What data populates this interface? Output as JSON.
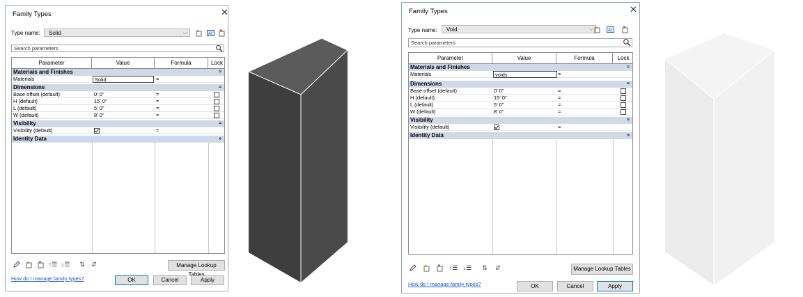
{
  "dialogs": [
    {
      "title": "Family Types",
      "type_name_label": "Type name:",
      "type_name": "Solid",
      "search_placeholder": "Search parameters",
      "columns": [
        "Parameter",
        "Value",
        "Formula",
        "Lock"
      ],
      "groups": [
        {
          "label": "Materials and Finishes",
          "chevron": "≈",
          "rows": [
            {
              "param": "Materials",
              "value": "Solid",
              "formula": "=",
              "lock": "",
              "value_box": true
            }
          ]
        },
        {
          "label": "Dimensions",
          "chevron": "≈",
          "rows": [
            {
              "param": "Base offset (default)",
              "value": "0'  0\"",
              "formula": "=",
              "lock": "checkbox"
            },
            {
              "param": "H (default)",
              "value": "15'  0\"",
              "formula": "=",
              "lock": "checkbox"
            },
            {
              "param": "L (default)",
              "value": "5'  0\"",
              "formula": "=",
              "lock": "checkbox"
            },
            {
              "param": "W (default)",
              "value": "8'  0\"",
              "formula": "=",
              "lock": "checkbox"
            }
          ]
        },
        {
          "label": "Visibility",
          "chevron": "≈",
          "rows": [
            {
              "param": "Visibility (default)",
              "value": "checked",
              "formula": "=",
              "lock": ""
            }
          ]
        },
        {
          "label": "Identity Data",
          "chevron": "»",
          "rows": []
        }
      ],
      "manage_lookup_label": "Manage Lookup Tables",
      "help_link": "How do I manage family types?",
      "ok_label": "OK",
      "cancel_label": "Cancel",
      "apply_label": "Apply"
    },
    {
      "title": "Family Types",
      "type_name_label": "Type name:",
      "type_name": "Void",
      "search_placeholder": "Search parameters",
      "columns": [
        "Parameter",
        "Value",
        "Formula",
        "Lock"
      ],
      "groups": [
        {
          "label": "Materials and Finishes",
          "chevron": "≈",
          "rows": [
            {
              "param": "Materials",
              "value": "voids",
              "formula": "=",
              "lock": "",
              "value_box": true
            }
          ]
        },
        {
          "label": "Dimensions",
          "chevron": "≈",
          "rows": [
            {
              "param": "Base offset (default)",
              "value": "0'  0\"",
              "formula": "=",
              "lock": "checkbox"
            },
            {
              "param": "H (default)",
              "value": "15'  0\"",
              "formula": "=",
              "lock": "checkbox"
            },
            {
              "param": "L (default)",
              "value": "5'  0\"",
              "formula": "=",
              "lock": "checkbox"
            },
            {
              "param": "W (default)",
              "value": "8'  0\"",
              "formula": "=",
              "lock": "checkbox"
            }
          ]
        },
        {
          "label": "Visibility",
          "chevron": "≈",
          "rows": [
            {
              "param": "Visibility (default)",
              "value": "checked",
              "formula": "=",
              "lock": ""
            }
          ]
        },
        {
          "label": "Identity Data",
          "chevron": "»",
          "rows": []
        }
      ],
      "manage_lookup_label": "Manage Lookup Tables",
      "help_link": "How do I manage family types?",
      "ok_label": "OK",
      "cancel_label": "Cancel",
      "apply_label": "Apply"
    }
  ],
  "shapes": [
    {
      "name": "solid-box",
      "top": "#5b5b5b",
      "left": "#3e3e3e",
      "right": "#4a4a4a",
      "edge": "#ffffff"
    },
    {
      "name": "void-box",
      "top": "#f4f4f4",
      "left": "#ececec",
      "right": "#f1f1f1",
      "edge": "#ffffff"
    }
  ],
  "colors": {
    "group_header": "#cfd9e8",
    "link": "#1a56c6",
    "primary_border": "#0078d7"
  }
}
